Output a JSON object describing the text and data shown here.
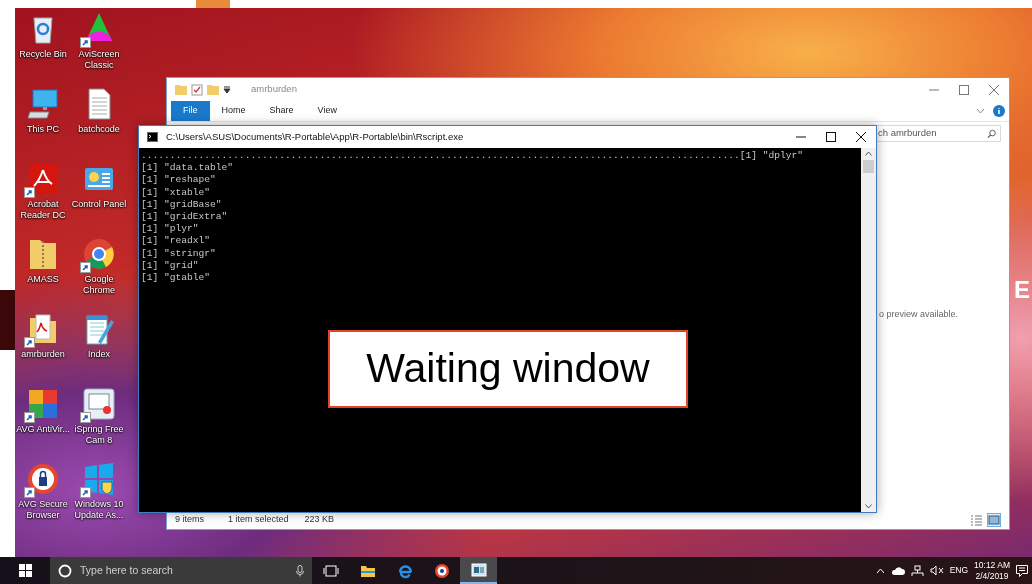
{
  "desktop": {
    "icons": [
      {
        "kind": "recycle-bin",
        "label": "Recycle Bin",
        "shortcut": false
      },
      {
        "kind": "triangle",
        "label": "AviScreen Classic",
        "shortcut": true
      },
      {
        "kind": "computer",
        "label": "This PC",
        "shortcut": false
      },
      {
        "kind": "document",
        "label": "batchcode",
        "shortcut": false
      },
      {
        "kind": "pdf",
        "label": "Acrobat Reader DC",
        "shortcut": true
      },
      {
        "kind": "control-panel",
        "label": "Control Panel",
        "shortcut": false
      },
      {
        "kind": "zip-folder",
        "label": "AMASS",
        "shortcut": false
      },
      {
        "kind": "circle-logo",
        "label": "Google Chrome",
        "shortcut": true
      },
      {
        "kind": "pdf-folder",
        "label": "amrburden",
        "shortcut": true
      },
      {
        "kind": "notepad",
        "label": "Index",
        "shortcut": false
      },
      {
        "kind": "squares",
        "label": "AVG AntiVir...",
        "shortcut": true
      },
      {
        "kind": "screen-record",
        "label": "iSpring Free Cam 8",
        "shortcut": true
      },
      {
        "kind": "lock-circle",
        "label": "AVG Secure Browser",
        "shortcut": true
      },
      {
        "kind": "window-panes",
        "label": "Windows 10 Update As...",
        "shortcut": true
      }
    ],
    "edge_text": "E"
  },
  "explorer_window": {
    "title": "amrburden",
    "ribbon_tabs": [
      {
        "label": "File",
        "selected": true
      },
      {
        "label": "Home",
        "selected": false
      },
      {
        "label": "Share",
        "selected": false
      },
      {
        "label": "View",
        "selected": false
      }
    ],
    "search": {
      "placeholder": "ch amrburden"
    },
    "preview_message": "o preview available.",
    "status_bar": {
      "item_count": "9 items",
      "selection": "1 item selected",
      "size": "223 KB"
    },
    "view_buttons": [
      {
        "kind": "details",
        "selected": false
      },
      {
        "kind": "large-icons",
        "selected": true
      }
    ]
  },
  "console_window": {
    "title": "C:\\Users\\ASUS\\Documents\\R-Portable\\App\\R-Portable\\bin\\Rscript.exe",
    "lines": [
      "........................................................................................................[1] \"dplyr\"",
      "[1] \"data.table\"",
      "[1] \"reshape\"",
      "[1] \"xtable\"",
      "[1] \"gridBase\"",
      "[1] \"gridExtra\"",
      "[1] \"plyr\"",
      "[1] \"readxl\"",
      "[1] \"stringr\"",
      "[1] \"grid\"",
      "[1] \"gtable\""
    ]
  },
  "annotation": {
    "text": "Waiting window"
  },
  "taskbar": {
    "search_placeholder": "Type here to search",
    "apps": [
      {
        "kind": "task-view",
        "active": false
      },
      {
        "kind": "folder",
        "active": false
      },
      {
        "kind": "swirl",
        "active": false
      },
      {
        "kind": "circle-browser",
        "active": false
      },
      {
        "kind": "console",
        "active": true
      }
    ],
    "language": "ENG",
    "time": "10:12 AM",
    "date": "2/4/2019"
  }
}
